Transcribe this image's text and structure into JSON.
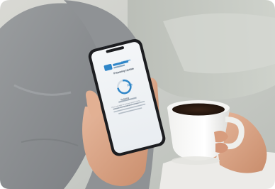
{
  "phone_screen": {
    "status_time": "9:41",
    "logo_text": "TOSHIBA",
    "title": "Preparing Update",
    "progress_label": "76%",
    "status_text": "Updating",
    "message": "Please wait while the firmware update is being prepared. This may take up to 2 minutes."
  },
  "colors": {
    "accent": "#2f86c8",
    "background": "#ffffff",
    "coffee": "#2a1a12"
  }
}
